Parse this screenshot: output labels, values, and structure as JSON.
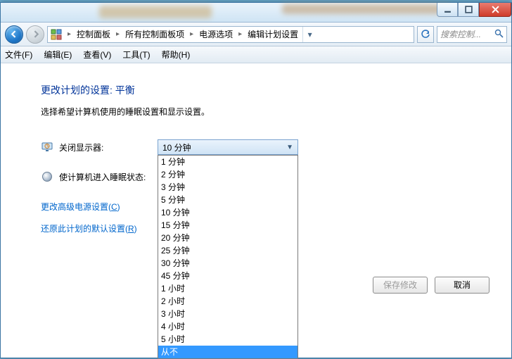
{
  "titlebar": {
    "min_tip": "最小化",
    "max_tip": "最大化",
    "close_tip": "关闭"
  },
  "nav": {
    "back_tip": "后退",
    "fwd_tip": "前进"
  },
  "breadcrumb": {
    "seg0": "控制面板",
    "seg1": "所有控制面板项",
    "seg2": "电源选项",
    "seg3": "编辑计划设置"
  },
  "search": {
    "placeholder": "搜索控制..."
  },
  "menubar": {
    "file": "文件(F)",
    "edit": "编辑(E)",
    "view": "查看(V)",
    "tools": "工具(T)",
    "help": "帮助(H)"
  },
  "content": {
    "heading": "更改计划的设置: 平衡",
    "subtitle": "选择希望计算机使用的睡眠设置和显示设置。",
    "row_display_label": "关闭显示器:",
    "row_sleep_label": "使计算机进入睡眠状态:",
    "display_dropdown_value": "10 分钟",
    "dropdown_options": {
      "o0": "1 分钟",
      "o1": "2 分钟",
      "o2": "3 分钟",
      "o3": "5 分钟",
      "o4": "10 分钟",
      "o5": "15 分钟",
      "o6": "20 分钟",
      "o7": "25 分钟",
      "o8": "30 分钟",
      "o9": "45 分钟",
      "o10": "1 小时",
      "o11": "2 小时",
      "o12": "3 小时",
      "o13": "4 小时",
      "o14": "5 小时",
      "o15": "从不"
    },
    "links": {
      "advanced_pre": "更改高级电源设置(",
      "advanced_accel": "C",
      "advanced_post": ")",
      "restore_pre": "还原此计划的默认设置(",
      "restore_accel": "R",
      "restore_post": ")"
    },
    "buttons": {
      "save": "保存修改",
      "cancel": "取消"
    }
  }
}
